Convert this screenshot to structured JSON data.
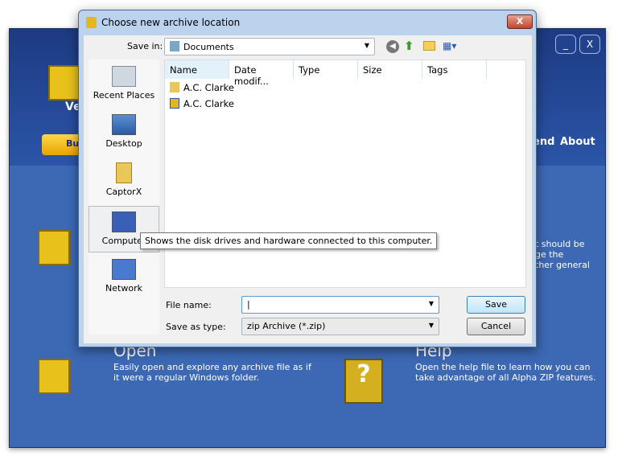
{
  "app": {
    "title_partial": "Ve",
    "buy_partial": "Bu",
    "nav": [
      "end",
      "About"
    ],
    "right_text": [
      "t should be",
      "ge the",
      "ther general"
    ],
    "open": {
      "title": "Open",
      "desc": "Easily open and explore any archive file as if it were a regular Windows folder."
    },
    "help": {
      "title": "Help",
      "desc": "Open the help file to learn how you can take advantage of all Alpha ZIP features."
    },
    "minimize": "_",
    "close": "X"
  },
  "dialog": {
    "title": "Choose new archive location",
    "close": "X",
    "save_in_label": "Save in:",
    "save_in_value": "Documents",
    "places": [
      "Recent Places",
      "Desktop",
      "CaptorX",
      "Computer",
      "Network"
    ],
    "columns": [
      "Name",
      "Date modif...",
      "Type",
      "Size",
      "Tags"
    ],
    "files": [
      {
        "name": "A.C. Clarke",
        "icon": "folder-icon"
      },
      {
        "name": "A.C. Clarke",
        "icon": "alphazip-icon"
      }
    ],
    "file_name_label": "File name:",
    "file_name_value": "",
    "save_type_label": "Save as type:",
    "save_type_value": "zip Archive (*.zip)",
    "save": "Save",
    "cancel": "Cancel",
    "tooltip": "Shows the disk drives and hardware connected to this computer."
  }
}
